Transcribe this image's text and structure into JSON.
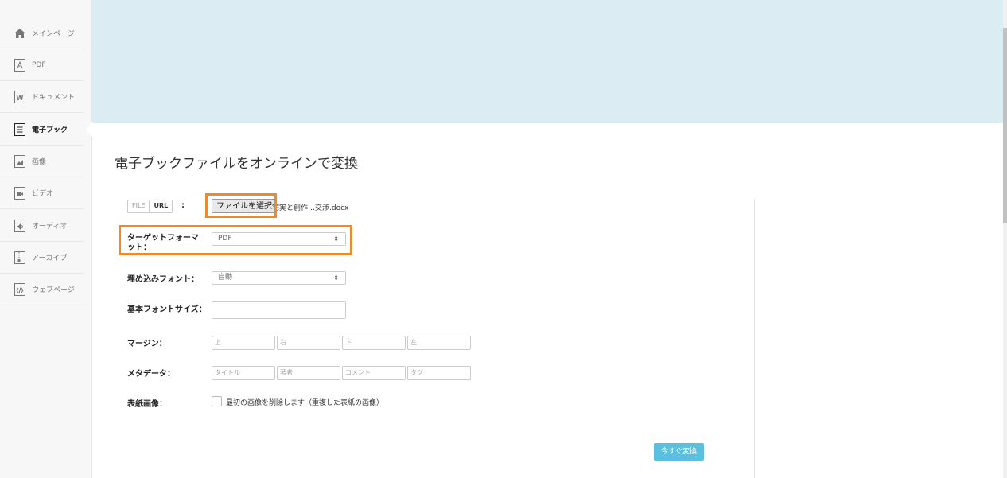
{
  "sidebar": {
    "items": [
      {
        "label": "メインページ",
        "icon": "home-icon"
      },
      {
        "label": "PDF",
        "icon": "pdf-file-icon"
      },
      {
        "label": "ドキュメント",
        "icon": "word-file-icon"
      },
      {
        "label": "電子ブック",
        "icon": "ebook-file-icon"
      },
      {
        "label": "画像",
        "icon": "image-file-icon"
      },
      {
        "label": "ビデオ",
        "icon": "video-file-icon"
      },
      {
        "label": "オーディオ",
        "icon": "audio-file-icon"
      },
      {
        "label": "アーカイブ",
        "icon": "archive-file-icon"
      },
      {
        "label": "ウェブページ",
        "icon": "webpage-file-icon"
      }
    ],
    "active_index": 3
  },
  "main": {
    "title": "電子ブックファイルをオンラインで変換",
    "source_toggle": {
      "file": "FILE",
      "url": "URL",
      "colon": ":"
    },
    "file_button": "ファイルを選択",
    "file_name": "宅実と創作…交渉.docx",
    "target_format": {
      "label": "ターゲットフォーマット：",
      "value": "PDF"
    },
    "embed_font": {
      "label": "埋め込みフォント：",
      "value": "自動"
    },
    "base_font_size": {
      "label": "基本フォントサイズ：",
      "value": ""
    },
    "margin": {
      "label": "マージン：",
      "top": "上",
      "right": "右",
      "bottom": "下",
      "left": "左"
    },
    "metadata": {
      "label": "メタデータ：",
      "title": "タイトル",
      "author": "著者",
      "comment": "コメント",
      "tag": "タグ"
    },
    "cover": {
      "label": "表紙画像：",
      "checkbox_label": "最初の画像を削除します（重複した表紙の画像）"
    },
    "convert_button": "今すぐ変換"
  },
  "colors": {
    "banner": "#dbecf3",
    "highlight": "#ed8a2c",
    "convert_button": "#5bc0de"
  }
}
